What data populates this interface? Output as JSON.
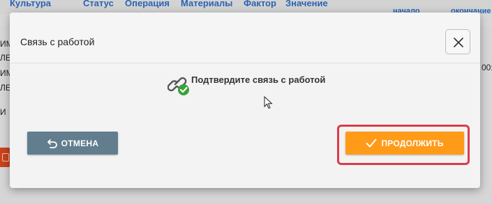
{
  "background": {
    "columns": [
      "Культура",
      "Статус",
      "Операция",
      "Материалы",
      "Фактор",
      "Значение"
    ],
    "sub_columns": [
      "начало",
      "окончание"
    ],
    "row_fragments": [
      "ИМ",
      "ЛЕ",
      "ИМ",
      "ЛЕ",
      "И"
    ],
    "right_fragment": "00:"
  },
  "dialog": {
    "title": "Связь с работой",
    "message": "Подтвердите связь с работой",
    "cancel_label": "ОТМЕНА",
    "continue_label": "ПРОДОЛЖИТЬ"
  },
  "colors": {
    "cancel_bg": "#627e8e",
    "continue_bg": "#ff9b18",
    "highlight": "#dc3b4a",
    "link_icon_check": "#3aa23a",
    "header_text": "#2b63b3"
  },
  "icons": {
    "close": "close-icon",
    "link_check": "link-check-icon",
    "undo": "undo-arrow-icon",
    "check": "check-icon",
    "cursor": "mouse-cursor-icon"
  }
}
